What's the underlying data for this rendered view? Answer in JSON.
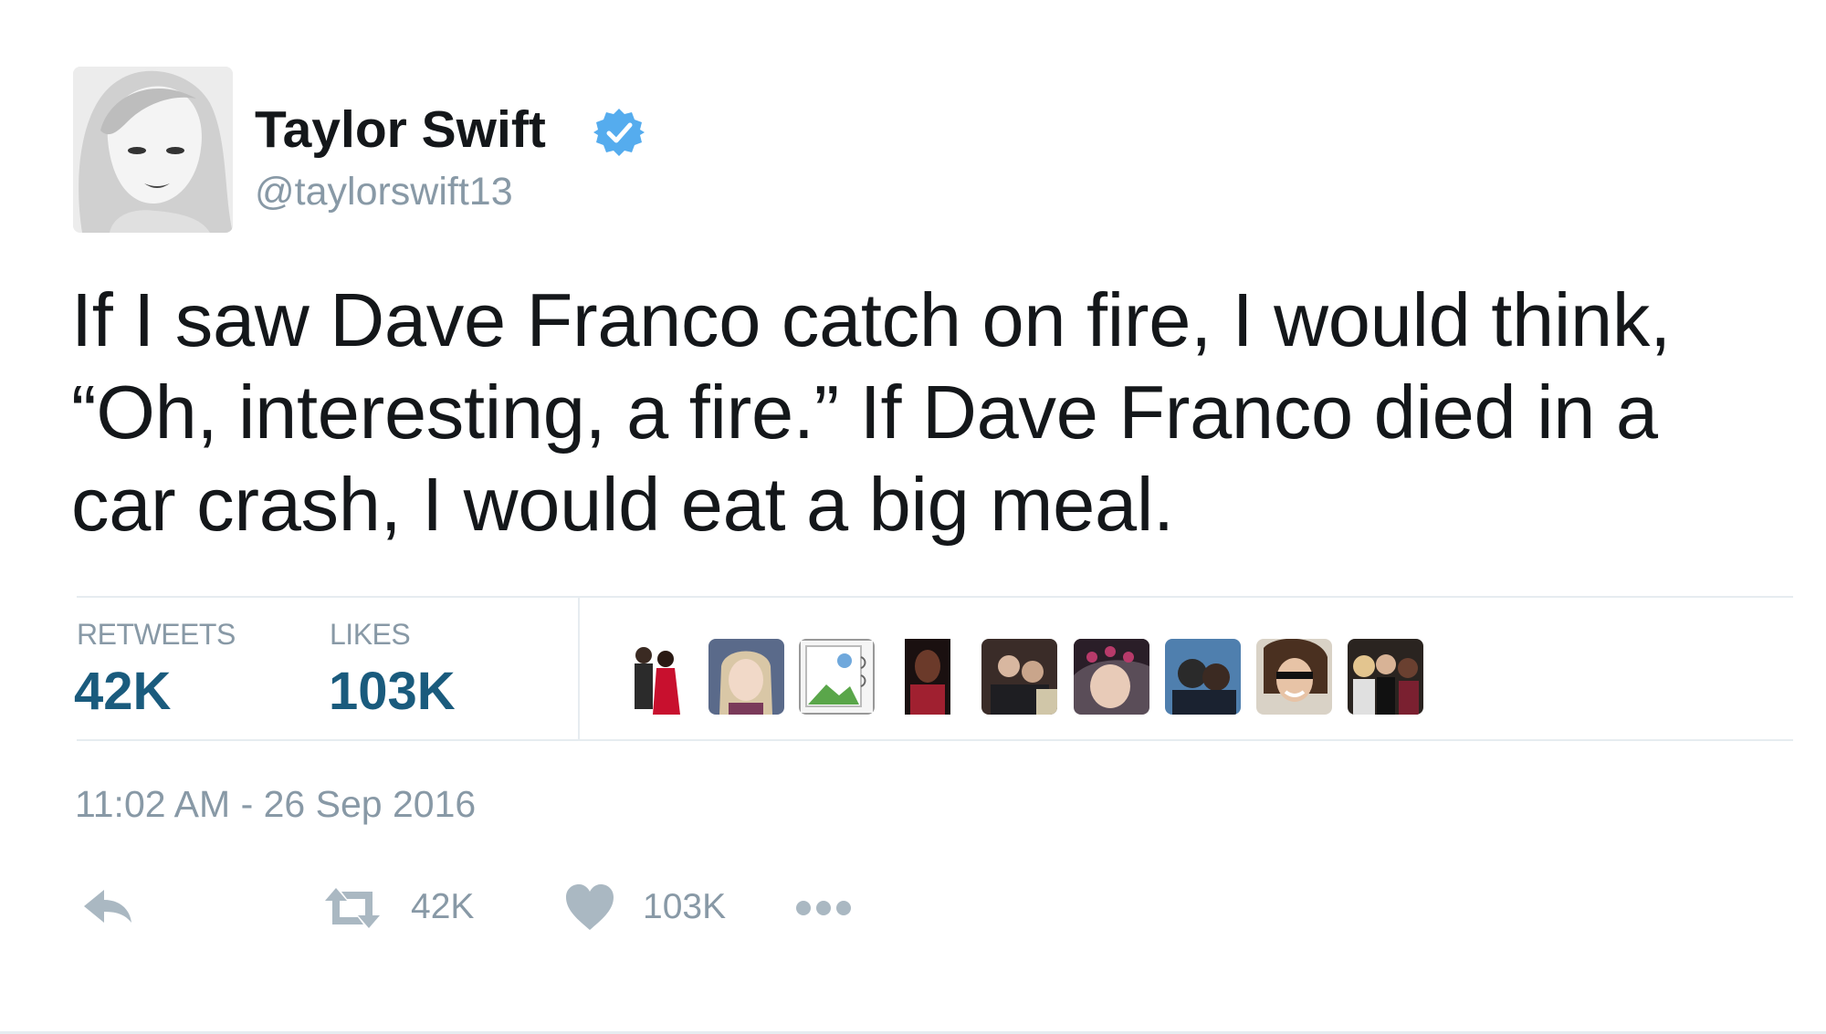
{
  "author": {
    "name": "Taylor Swift",
    "handle": "@taylorswift13",
    "verified": true
  },
  "tweet": {
    "lines": [
      "If I saw Dave Franco catch on fire, I would think,",
      "“Oh, interesting, a fire.” If Dave Franco died in a",
      "car crash, I would eat a big meal."
    ]
  },
  "stats": {
    "retweets_label": "RETWEETS",
    "retweets_value": "42K",
    "likes_label": "LIKES",
    "likes_value": "103K"
  },
  "timestamp": "11:02 AM - 26 Sep 2016",
  "actions": {
    "retweet_count": "42K",
    "like_count": "103K"
  },
  "colors": {
    "stat_value": "#1a5b7d",
    "muted": "#8899a6",
    "verified": "#55acee"
  },
  "icons": [
    "verified-badge-icon",
    "reply-icon",
    "retweet-icon",
    "heart-icon",
    "more-icon"
  ]
}
